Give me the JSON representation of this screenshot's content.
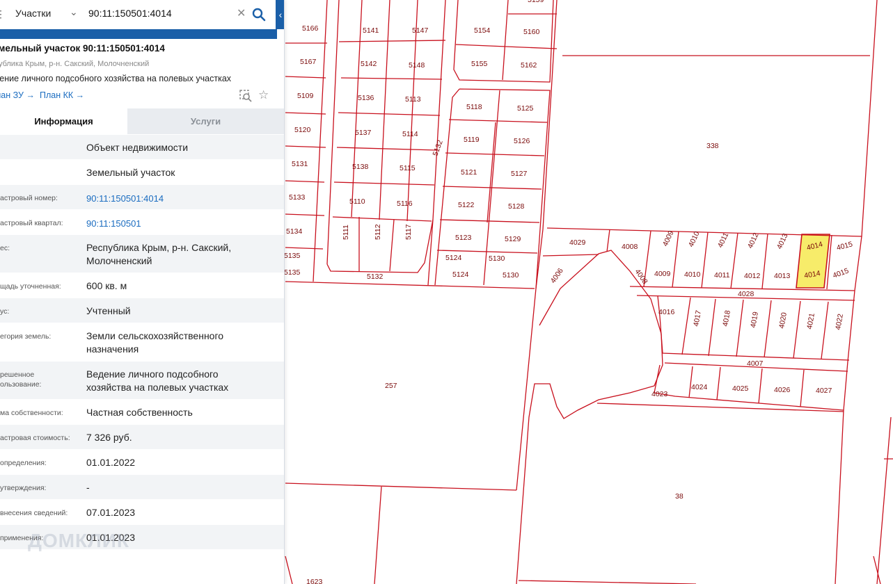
{
  "search": {
    "layer": "Участки",
    "value": "90:11:150501:4014",
    "clear_icon": "close-icon",
    "search_icon": "search-icon"
  },
  "collapse_icon": "chevron-left-icon",
  "object": {
    "title": "емельный участок 90:11:150501:4014",
    "address": "публика Крым, р-н. Сакский, Молочненский",
    "use": "дение личного подсобного хозяйства на полевых участках",
    "link_zu": "лан ЗУ →",
    "link_kk": "План КК →"
  },
  "tabs": {
    "info": "Информация",
    "services": "Услуги"
  },
  "rows": [
    {
      "k": "",
      "v": "Объект недвижимости"
    },
    {
      "k": "",
      "v": "Земельный участок"
    },
    {
      "k": "астровый номер:",
      "v": "90:11:150501:4014",
      "link": true
    },
    {
      "k": "астровый квартал:",
      "v": "90:11:150501",
      "link": true
    },
    {
      "k": "ес:",
      "v": "Республика Крым, р-н. Сакский,\nМолочненский"
    },
    {
      "k": "щадь уточненная:",
      "v": "600 кв. м"
    },
    {
      "k": "ус:",
      "v": "Учтенный"
    },
    {
      "k": "егория земель:",
      "v": "Земли сельскохозяйственного\nназначения"
    },
    {
      "k": "решенное\nользование:",
      "v": "Ведение личного подсобного\nхозяйства на полевых участках"
    },
    {
      "k": "ма собственности:",
      "v": "Частная собственность"
    },
    {
      "k": "астровая стоимость:",
      "v": "7 326 руб."
    },
    {
      "k": "определения:",
      "v": "01.01.2022"
    },
    {
      "k": "утверждения:",
      "v": "-"
    },
    {
      "k": "внесения сведений:",
      "v": "07.01.2023"
    },
    {
      "k": "применения:",
      "v": "01.01.2023"
    }
  ],
  "watermark": "ДОМКЛИК",
  "map": {
    "line_color": "#c8101d",
    "label_color": "#7a0a0a",
    "highlight_fill": "#f7ec6a",
    "labels": [
      {
        "t": "5166"
      },
      {
        "t": "5141"
      },
      {
        "t": "5147"
      },
      {
        "t": "5154"
      },
      {
        "t": "5160"
      },
      {
        "t": "5167"
      },
      {
        "t": "5142"
      },
      {
        "t": "5148"
      },
      {
        "t": "5155"
      },
      {
        "t": "5162"
      },
      {
        "t": "5109"
      },
      {
        "t": "5136"
      },
      {
        "t": "5113"
      },
      {
        "t": "5118"
      },
      {
        "t": "5125"
      },
      {
        "t": "5120"
      },
      {
        "t": "5137"
      },
      {
        "t": "5114"
      },
      {
        "t": "5119"
      },
      {
        "t": "5126"
      },
      {
        "t": "5131"
      },
      {
        "t": "5138"
      },
      {
        "t": "5115"
      },
      {
        "t": "5121"
      },
      {
        "t": "5127"
      },
      {
        "t": "5133"
      },
      {
        "t": "5110"
      },
      {
        "t": "5116"
      },
      {
        "t": "5122"
      },
      {
        "t": "5128"
      },
      {
        "t": "5134"
      },
      {
        "t": "5123"
      },
      {
        "t": "5129"
      },
      {
        "t": "5135"
      },
      {
        "t": "5135"
      },
      {
        "t": "5124"
      },
      {
        "t": "5130"
      },
      {
        "t": "5124"
      },
      {
        "t": "5130"
      },
      {
        "t": "5132"
      },
      {
        "t": "5111"
      },
      {
        "t": "5112"
      },
      {
        "t": "5117"
      },
      {
        "t": "5132"
      },
      {
        "t": "338"
      },
      {
        "t": "4029"
      },
      {
        "t": "4008"
      },
      {
        "t": "4009"
      },
      {
        "t": "4010"
      },
      {
        "t": "4011"
      },
      {
        "t": "4012"
      },
      {
        "t": "4013"
      },
      {
        "t": "4014"
      },
      {
        "t": "4015"
      },
      {
        "t": "4008"
      },
      {
        "t": "4009"
      },
      {
        "t": "4010"
      },
      {
        "t": "4011"
      },
      {
        "t": "4012"
      },
      {
        "t": "4013"
      },
      {
        "t": "4014"
      },
      {
        "t": "4015"
      },
      {
        "t": "4006"
      },
      {
        "t": "4028"
      },
      {
        "t": "4016"
      },
      {
        "t": "4017"
      },
      {
        "t": "4018"
      },
      {
        "t": "4019"
      },
      {
        "t": "4020"
      },
      {
        "t": "4021"
      },
      {
        "t": "4022"
      },
      {
        "t": "4007"
      },
      {
        "t": "4023"
      },
      {
        "t": "4024"
      },
      {
        "t": "4025"
      },
      {
        "t": "4026"
      },
      {
        "t": "4027"
      },
      {
        "t": "257"
      },
      {
        "t": "38"
      },
      {
        "t": "1623"
      },
      {
        "t": "5159"
      }
    ]
  }
}
